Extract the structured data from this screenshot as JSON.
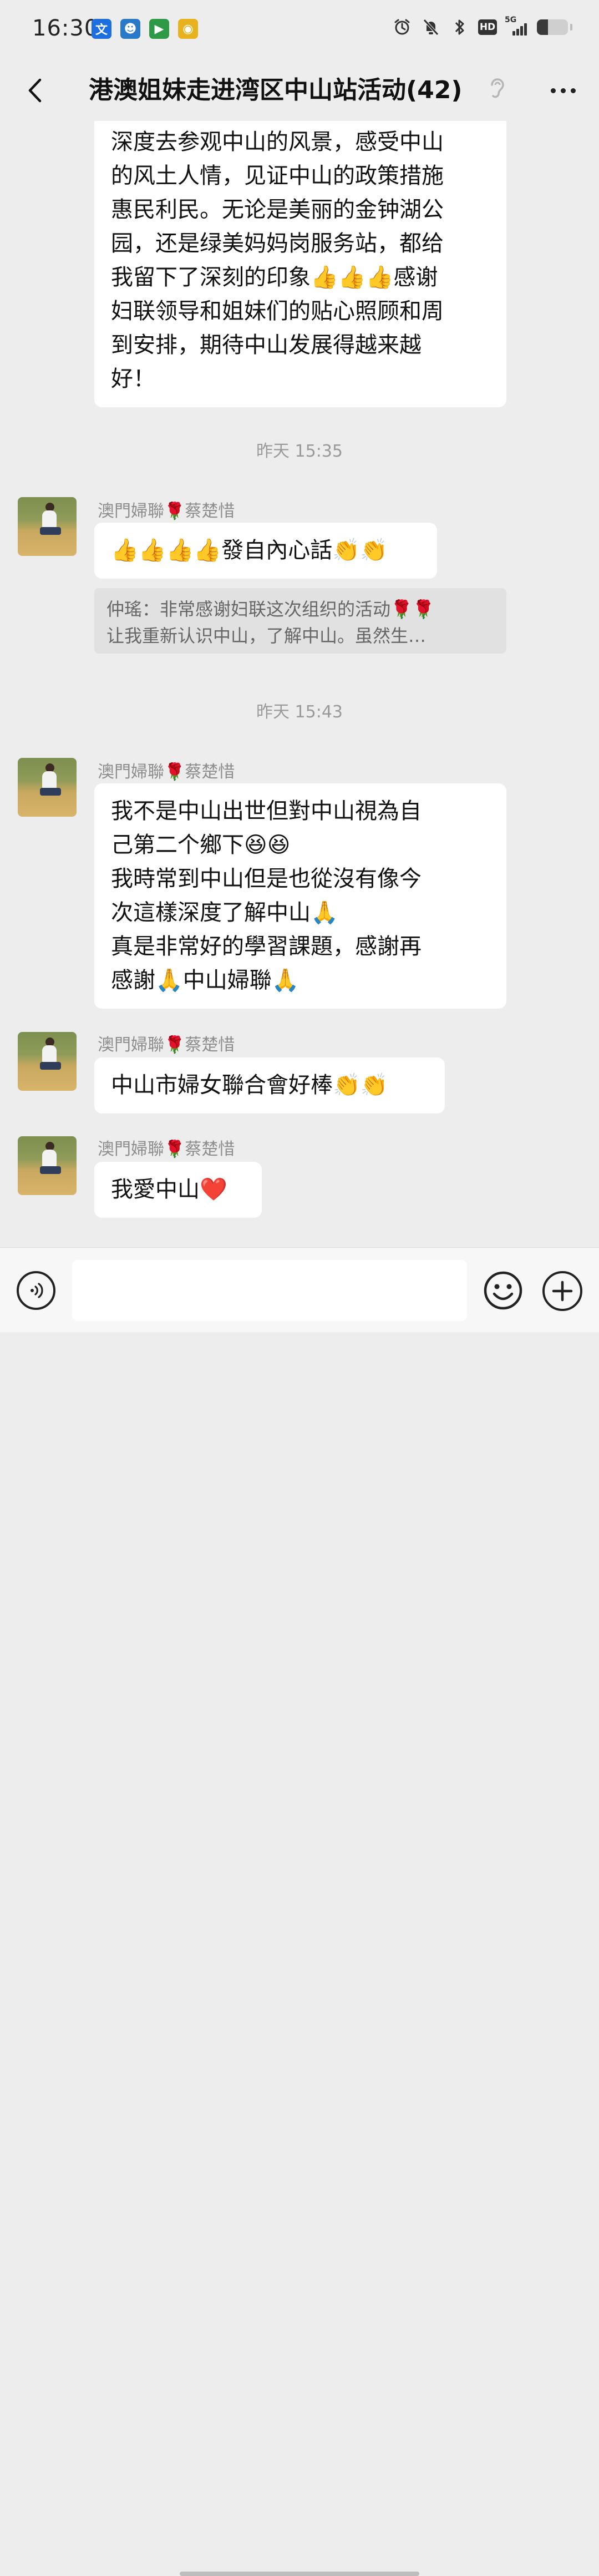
{
  "status_bar": {
    "time": "16:30",
    "app_icons": [
      {
        "name": "translate-app-icon",
        "glyph": "文",
        "color": "#1d6fe0"
      },
      {
        "name": "mascot-app-icon",
        "glyph": "☻",
        "color": "#2a79c9"
      },
      {
        "name": "video-app-icon",
        "glyph": "▶",
        "color": "#2f9a45"
      },
      {
        "name": "weibo-app-icon",
        "glyph": "◉",
        "color": "#e8b21f"
      }
    ],
    "network": "5G",
    "hd_label": "HD",
    "battery_level": 0.35
  },
  "header": {
    "back_icon": "chevron-left-icon",
    "title": "港澳姐妹走进湾区中山站活动(42)",
    "ear_icon": "ear-icon",
    "more_icon": "more-dots-icon"
  },
  "messages": [
    {
      "type": "text",
      "text": "深度去参观中山的风景，感受中山\n的风土人情，见证中山的政策措施\n惠民利民。无论是美丽的金钟湖公\n园，还是绿美妈妈岗服务站，都给\n我留下了深刻的印象👍👍👍感谢\n妇联领导和姐妹们的贴心照顾和周\n到安排，期待中山发展得越来越\n好！"
    },
    {
      "type": "timestamp",
      "text": "昨天 15:35"
    },
    {
      "type": "text",
      "sender": "澳門婦聯🌹蔡楚惜",
      "text": "👍👍👍👍發自內心話👏👏",
      "quote": "仲瑤：非常感谢妇联这次组织的活动🌹🌹\n让我重新认识中山，了解中山。虽然生…"
    },
    {
      "type": "timestamp",
      "text": "昨天 15:43"
    },
    {
      "type": "text",
      "sender": "澳門婦聯🌹蔡楚惜",
      "text": "我不是中山出世但對中山視為自\n己第二个鄉下😆😆\n我時常到中山但是也從沒有像今\n次這樣深度了解中山🙏\n真是非常好的學習課題，感謝再\n感謝🙏中山婦聯🙏"
    },
    {
      "type": "text",
      "sender": "澳門婦聯🌹蔡楚惜",
      "text": "中山市婦女聯合會好棒👏👏"
    },
    {
      "type": "text",
      "sender": "澳門婦聯🌹蔡楚惜",
      "text": "我愛中山❤️"
    }
  ],
  "input_bar": {
    "voice_icon": "voice-icon",
    "input_value": "",
    "emoji_icon": "emoji-icon",
    "plus_icon": "plus-icon"
  }
}
